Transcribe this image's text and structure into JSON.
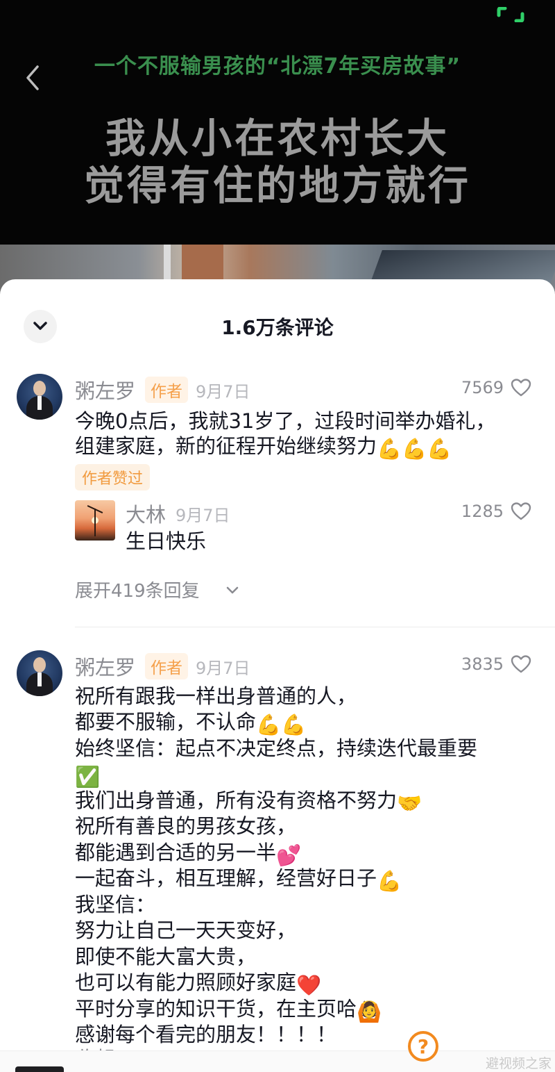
{
  "video": {
    "subtitle": "一个不服输男孩的“北漂7年买房故事”",
    "title_line1": "我从小在农村长大",
    "title_line2": "觉得有住的地方就行"
  },
  "sheet": {
    "title": "1.6万条评论"
  },
  "comments": [
    {
      "author": "粥左罗",
      "tag": "作者",
      "date": "9月7日",
      "likes": "7569",
      "lines": [
        "今晚0点后，我就31岁了，过段时间举办婚礼，",
        "组建家庭，新的征程开始继续努力"
      ],
      "emoji_line2": "💪💪💪",
      "badge": "作者赞过",
      "reply": {
        "author": "大林",
        "date": "9月7日",
        "likes": "1285",
        "text": "生日快乐"
      },
      "expand_label": "展开419条回复"
    },
    {
      "author": "粥左罗",
      "tag": "作者",
      "date": "9月7日",
      "likes": "3835",
      "lines": [
        "祝所有跟我一样出身普通的人，",
        "都要不服输，不认命",
        "始终坚信：起点不决定终点，持续迭代最重要",
        "",
        "我们出身普通，所有没有资格不努力",
        "祝所有善良的男孩女孩，",
        "都能遇到合适的另一半",
        "一起奋斗，相互理解，经营好日子",
        "我坚信：",
        "努力让自己一天天变好，",
        "即使不能大富大贵，",
        "也可以有能力照顾好家庭",
        "平时分享的知识干货，在主页哈",
        "感谢每个看完的朋友！！！！",
        "收起"
      ],
      "emojis": {
        "l1": "💪💪",
        "l3": "✅",
        "l4": "🤝",
        "l6": "💕",
        "l7": "💪",
        "l11": "❤️",
        "l12": "🙆"
      }
    }
  ],
  "watermark": "避视频之家",
  "icons": [
    "back-icon",
    "fullscreen-icon",
    "chevron-down-icon",
    "heart-icon",
    "help-icon"
  ]
}
